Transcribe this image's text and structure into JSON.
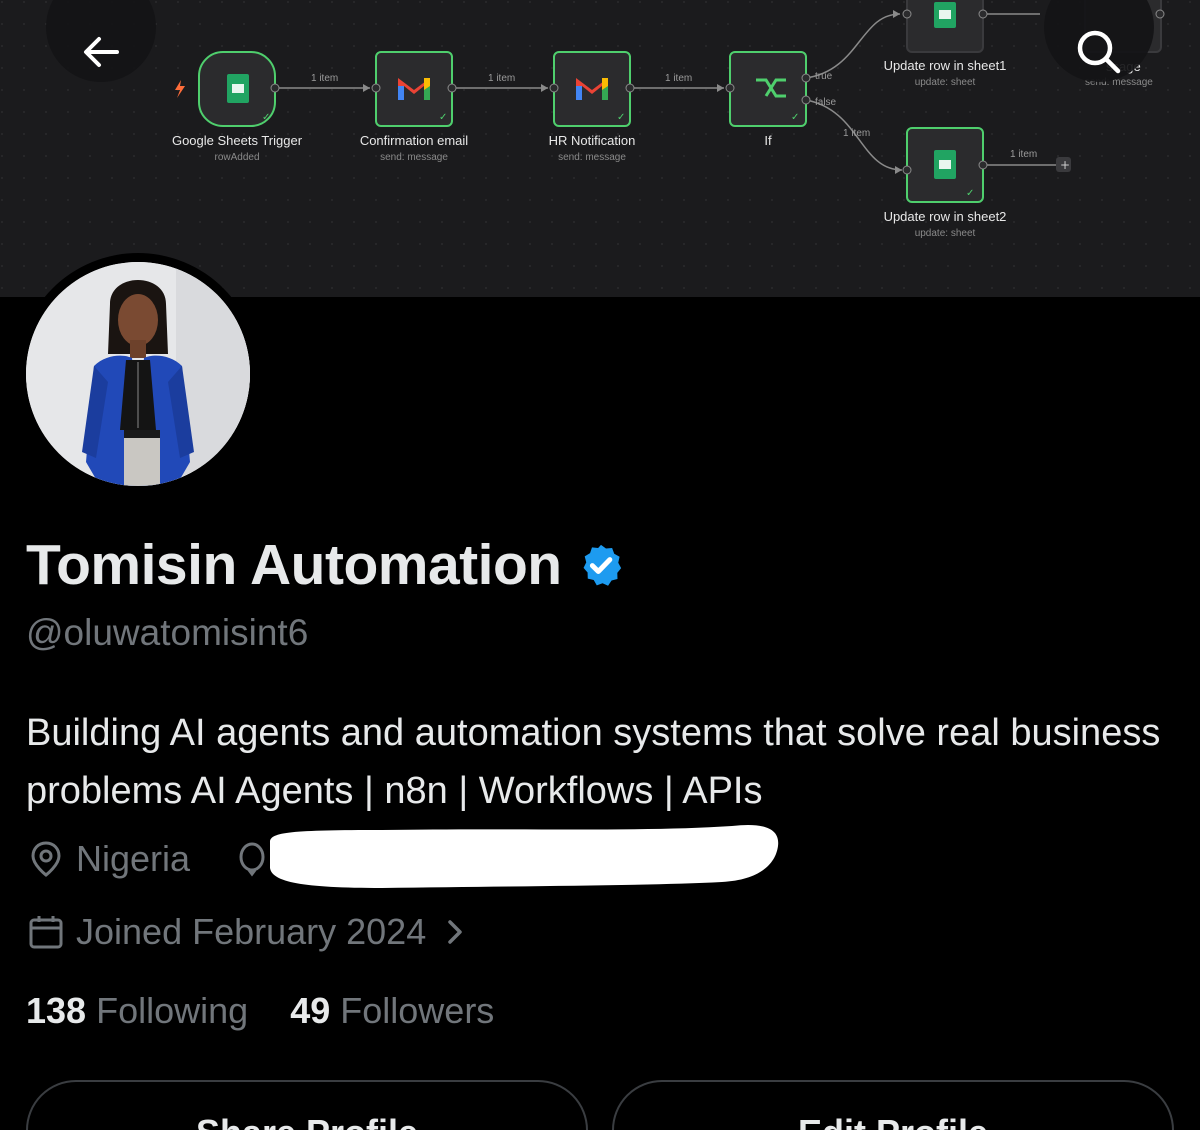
{
  "banner": {
    "nodes": [
      {
        "label": "Google Sheets Trigger",
        "sub": "rowAdded",
        "icon": "google-sheets-icon"
      },
      {
        "label": "Confirmation email",
        "sub": "send: message",
        "icon": "gmail-icon"
      },
      {
        "label": "HR Notification",
        "sub": "send: message",
        "icon": "gmail-icon"
      },
      {
        "label": "If",
        "sub": "",
        "icon": "if-branch-icon"
      },
      {
        "label": "Update row in sheet1",
        "sub": "update: sheet",
        "icon": "google-sheets-icon"
      },
      {
        "label": "Update row in sheet2",
        "sub": "update: sheet",
        "icon": "google-sheets-icon"
      },
      {
        "label": "ssage",
        "sub": "send: message",
        "icon": "gmail-icon"
      }
    ],
    "connections": [
      "1 item",
      "1 item",
      "1 item",
      "1 item",
      "1 item"
    ],
    "branch_true": "true",
    "branch_false": "false"
  },
  "nav": {
    "back_icon": "arrow-left-icon",
    "search_icon": "search-icon"
  },
  "profile": {
    "name": "Tomisin Automation",
    "handle": "@oluwatomisint6",
    "bio": "Building AI agents and automation systems that solve real business problems AI Agents | n8n | Workflows | APIs",
    "location": "Nigeria",
    "joined": "Joined February 2024",
    "following_count": "138",
    "following_label": "Following",
    "followers_count": "49",
    "followers_label": "Followers",
    "verified_color": "#1d9bf0"
  },
  "actions": {
    "share": "Share Profile",
    "edit": "Edit Profile"
  }
}
